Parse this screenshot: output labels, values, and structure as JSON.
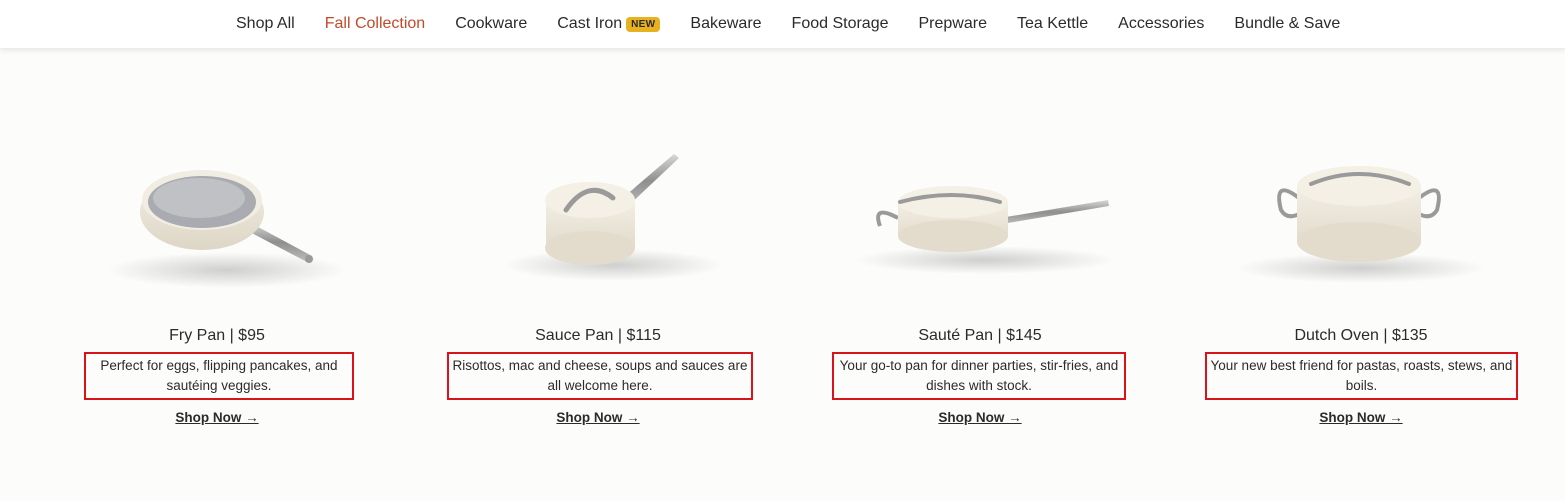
{
  "nav": {
    "items": [
      {
        "label": "Shop All"
      },
      {
        "label": "Fall Collection"
      },
      {
        "label": "Cookware"
      },
      {
        "label": "Cast Iron",
        "badge": "NEW"
      },
      {
        "label": "Bakeware"
      },
      {
        "label": "Food Storage"
      },
      {
        "label": "Prepware"
      },
      {
        "label": "Tea Kettle"
      },
      {
        "label": "Accessories"
      },
      {
        "label": "Bundle & Save"
      }
    ]
  },
  "colors": {
    "active_nav": "#c24a2a",
    "badge": "#e7b11f",
    "highlight_border": "#d9131c"
  },
  "products": [
    {
      "title": "Fry Pan | $95",
      "desc": "Perfect for eggs, flipping pancakes, and sautéing veggies.",
      "cta": "Shop Now →",
      "image": "fry-pan-image"
    },
    {
      "title": "Sauce Pan | $115",
      "desc": "Risottos, mac and cheese, soups and sauces are all welcome here.",
      "cta": "Shop Now →",
      "image": "sauce-pan-image"
    },
    {
      "title": "Sauté Pan | $145",
      "desc": "Your go-to pan for dinner parties, stir-fries, and dishes with stock.",
      "cta": "Shop Now →",
      "image": "saute-pan-image"
    },
    {
      "title": "Dutch Oven | $135",
      "desc": "Your new best friend for pastas, roasts, stews, and boils.",
      "cta": "Shop Now →",
      "image": "dutch-oven-image"
    }
  ]
}
